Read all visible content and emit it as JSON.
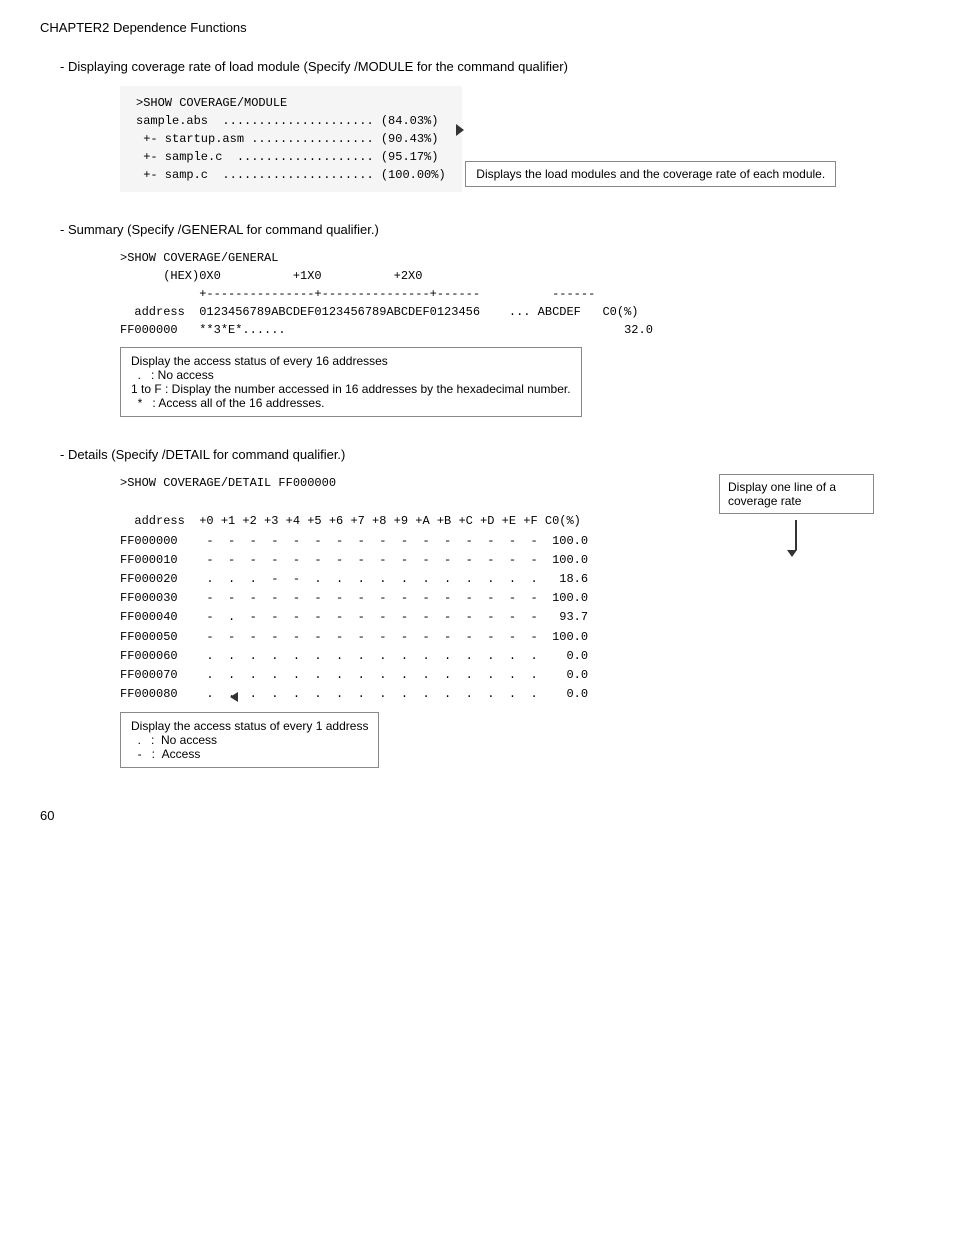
{
  "chapter": {
    "title": "CHAPTER2  Dependence Functions"
  },
  "page_number": "60",
  "sections": {
    "module": {
      "intro": "- Displaying coverage rate of load module (Specify /MODULE for the command qualifier)",
      "code": ">SHOW COVERAGE/MODULE\nsample.abs  ..................... (84.03%)\n +- startup.asm ................. (90.43%)\n +- sample.c  ................... (95.17%)\n +- samp.c  ..................... (100.00%)",
      "annotation": "Displays the load modules and the coverage rate of each module."
    },
    "summary": {
      "intro": "- Summary (Specify /GENERAL for command qualifier.)",
      "code": ">SHOW COVERAGE/GENERAL\n      (HEX)0X0          +1X0          +2X0\n           +---------------+---------------+------          ------\n  address  0123456789ABCDEF0123456789ABCDEF0123456    ... ABCDEF   C0(%)\nFF000000   **3*E*.......",
      "co_value": "32.0",
      "annotation_lines": [
        "Display the access status of every 16 addresses",
        "  .   : No access",
        "1 to F : Display the number accessed in 16 addresses by the hexadecimal number.",
        "  *   : Access all of the 16 addresses."
      ]
    },
    "detail": {
      "intro": "- Details (Specify /DETAIL for command qualifier.)",
      "callout": "Display one line of a coverage rate",
      "command": ">SHOW COVERAGE/DETAIL FF000000",
      "header": "  address  +0 +1 +2 +3 +4 +5 +6 +7 +8 +9 +A +B +C +D +E +F C0(%)",
      "rows": [
        {
          "addr": "FF000000",
          "data": " -  -  -  -  -  -  -  -  -  -  -  -  -  -  -  -",
          "co": "100.0"
        },
        {
          "addr": "FF000010",
          "data": " -  -  -  -  -  -  -  -  -  -  -  -  -  -  -  -",
          "co": "100.0"
        },
        {
          "addr": "FF000020",
          "data": " .  .  .  -  -  .  .  .  .  .  .  .  .  .  .  .",
          "co": "18.6"
        },
        {
          "addr": "FF000030",
          "data": " -  -  -  -  -  -  -  -  -  -  -  -  -  -  -  -",
          "co": "100.0"
        },
        {
          "addr": "FF000040",
          "data": " -  .  -  -  -  -  -  -  -  -  -  -  -  -  -  -",
          "co": "93.7"
        },
        {
          "addr": "FF000050",
          "data": " -  -  -  -  -  -  -  -  -  -  -  -  -  -  -  -",
          "co": "100.0"
        },
        {
          "addr": "FF000060",
          "data": " .  .  .  .  .  .  .  .  .  .  .  .  .  .  .  .",
          "co": "0.0"
        },
        {
          "addr": "FF000070",
          "data": " .  .  .  .  .  .  .  .  .  .  .  .  .  .  .  .",
          "co": "0.0"
        },
        {
          "addr": "FF000080",
          "data": " .  .  .  .  .  .  .  .  .  .  .  .  .  .  .  .",
          "co": "0.0"
        }
      ],
      "annotation_lines": [
        "Display the access status of every 1 address",
        "  .   :  No access",
        "  -   :  Access"
      ]
    }
  }
}
